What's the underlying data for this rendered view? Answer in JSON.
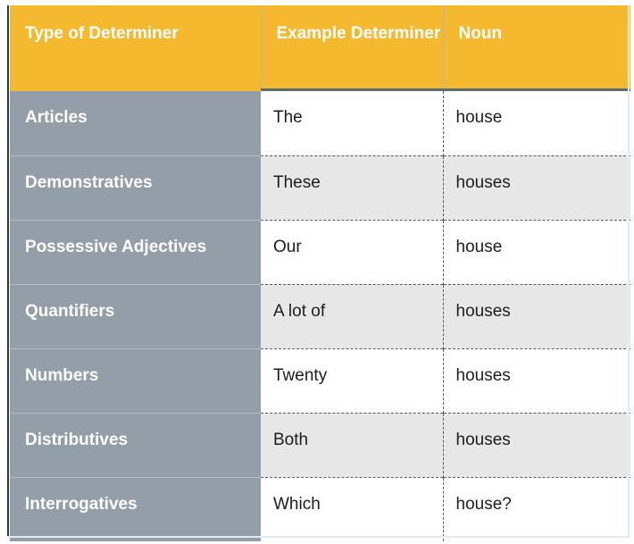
{
  "document": {
    "kind": "reference-table",
    "title": "Type of Determiner reference table"
  },
  "theme": {
    "header_background": "#f5b930",
    "header_text": "#ffffff",
    "row_label_background": "#949ea8",
    "row_label_text": "#ffffff",
    "row_shade_background": "#e7e7e7",
    "row_plain_background": "#ffffff",
    "cell_text": "#1d1d1d",
    "divider_dashed": "#5a5a5a",
    "divider_solid": "#b6bec6",
    "header_rule": "#5e6a72"
  },
  "table": {
    "columns": [
      {
        "key": "type",
        "label": "Type of Determiner"
      },
      {
        "key": "example",
        "label": "Example Determiner"
      },
      {
        "key": "noun",
        "label": "Noun"
      }
    ],
    "rows": [
      {
        "type": "Articles",
        "example": "The",
        "noun": "house"
      },
      {
        "type": "Demonstratives",
        "example": "These",
        "noun": "houses"
      },
      {
        "type": "Possessive Adjectives",
        "example": "Our",
        "noun": "house"
      },
      {
        "type": "Quantifiers",
        "example": "A lot of",
        "noun": "houses"
      },
      {
        "type": "Numbers",
        "example": "Twenty",
        "noun": "houses"
      },
      {
        "type": "Distributives",
        "example": "Both",
        "noun": "houses"
      },
      {
        "type": "Interrogatives",
        "example": "Which",
        "noun": "house?"
      }
    ]
  }
}
